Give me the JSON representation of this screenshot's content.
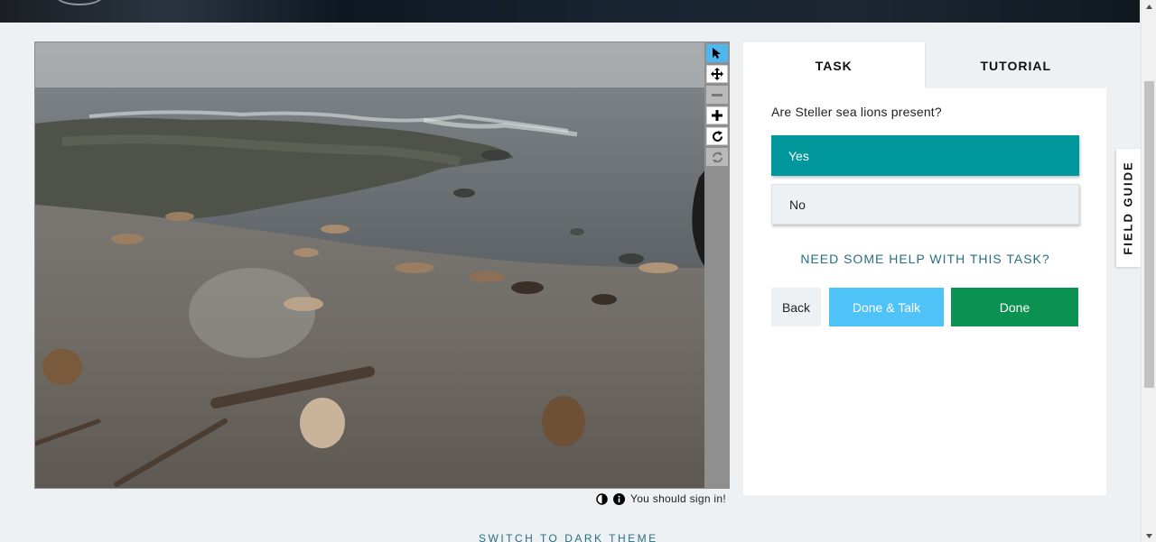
{
  "viewer": {
    "tools": [
      {
        "name": "pointer-tool",
        "icon": "arrow-cursor-icon"
      },
      {
        "name": "move-tool",
        "icon": "move-arrows-icon"
      },
      {
        "name": "zoom-out-tool",
        "icon": "minus-icon"
      },
      {
        "name": "zoom-in-tool",
        "icon": "plus-icon"
      },
      {
        "name": "rotate-tool",
        "icon": "rotate-icon"
      },
      {
        "name": "reset-tool",
        "icon": "reset-icon"
      }
    ],
    "footer_message": "You should sign in!",
    "footer_icons": [
      "contrast-icon",
      "info-icon"
    ]
  },
  "task_panel": {
    "tabs": [
      "TASK",
      "TUTORIAL"
    ],
    "question": "Are Steller sea lions present?",
    "answers": [
      "Yes",
      "No"
    ],
    "selected_answer": "Yes",
    "help_link": "NEED SOME HELP WITH THIS TASK?",
    "buttons": {
      "back": "Back",
      "done_talk": "Done & Talk",
      "done": "Done"
    }
  },
  "field_guide": {
    "label": "FIELD GUIDE"
  },
  "footer": {
    "theme_link": "SWITCH TO DARK THEME"
  },
  "colors": {
    "selected_answer": "#00979d",
    "done_talk": "#4fc3f7",
    "done": "#0b9150",
    "active_tool": "#4fb6ee",
    "link": "#2a6f80"
  }
}
